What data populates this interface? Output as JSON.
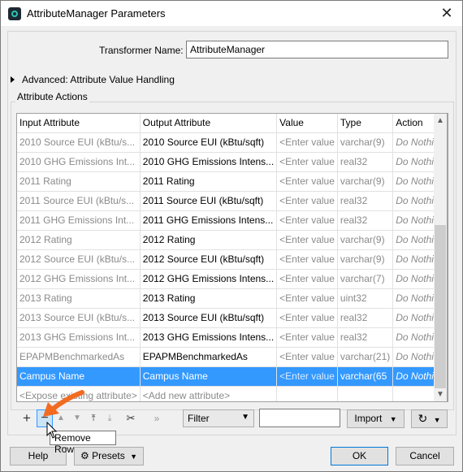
{
  "window": {
    "title": "AttributeManager Parameters"
  },
  "transformer": {
    "label": "Transformer Name:",
    "value": "AttributeManager"
  },
  "advanced": {
    "label": "Advanced: Attribute Value Handling"
  },
  "actions": {
    "label": "Attribute Actions",
    "columns": [
      "Input Attribute",
      "Output Attribute",
      "Value",
      "Type",
      "Action"
    ],
    "rows": [
      {
        "input": "2010 Source EUI (kBtu/s...",
        "output": "2010 Source EUI (kBtu/sqft)",
        "value": "<Enter value",
        "type": "varchar(9)",
        "action": "Do Nothing"
      },
      {
        "input": "2010 GHG Emissions Int...",
        "output": "2010 GHG Emissions Intens...",
        "value": "<Enter value",
        "type": "real32",
        "action": "Do Nothing"
      },
      {
        "input": "2011 Rating",
        "output": "2011 Rating",
        "value": "<Enter value",
        "type": "varchar(9)",
        "action": "Do Nothing"
      },
      {
        "input": "2011 Source EUI (kBtu/s...",
        "output": "2011 Source EUI (kBtu/sqft)",
        "value": "<Enter value",
        "type": "real32",
        "action": "Do Nothing"
      },
      {
        "input": "2011 GHG Emissions Int...",
        "output": "2011 GHG Emissions Intens...",
        "value": "<Enter value",
        "type": "real32",
        "action": "Do Nothing"
      },
      {
        "input": "2012 Rating",
        "output": "2012 Rating",
        "value": "<Enter value",
        "type": "varchar(9)",
        "action": "Do Nothing"
      },
      {
        "input": "2012 Source EUI (kBtu/s...",
        "output": "2012 Source EUI (kBtu/sqft)",
        "value": "<Enter value",
        "type": "varchar(9)",
        "action": "Do Nothing"
      },
      {
        "input": "2012 GHG Emissions Int...",
        "output": "2012 GHG Emissions Intens...",
        "value": "<Enter value",
        "type": "varchar(7)",
        "action": "Do Nothing"
      },
      {
        "input": "2013 Rating",
        "output": "2013 Rating",
        "value": "<Enter value",
        "type": "uint32",
        "action": "Do Nothing"
      },
      {
        "input": "2013 Source EUI (kBtu/s...",
        "output": "2013 Source EUI (kBtu/sqft)",
        "value": "<Enter value",
        "type": "real32",
        "action": "Do Nothing"
      },
      {
        "input": "2013 GHG Emissions Int...",
        "output": "2013 GHG Emissions Intens...",
        "value": "<Enter value",
        "type": "real32",
        "action": "Do Nothing"
      },
      {
        "input": "EPAPMBenchmarkedAs",
        "output": "EPAPMBenchmarkedAs",
        "value": "<Enter value",
        "type": "varchar(21)",
        "action": "Do Nothing"
      },
      {
        "input": "Campus Name",
        "output": "Campus Name",
        "value": "<Enter value",
        "type": "varchar(65",
        "action": "Do Nothing"
      }
    ],
    "new_row": {
      "input": "<Expose existing attribute>",
      "output": "<Add new attribute>"
    },
    "selected_index": 12
  },
  "toolbar": {
    "filter_select": "Filter",
    "import_label": "Import",
    "icons": [
      "plus-icon",
      "minus-icon",
      "move-up-icon",
      "move-down-icon",
      "move-top-icon",
      "move-bottom-icon",
      "cut-icon",
      "expand-icon"
    ]
  },
  "tooltip": "Remove Row",
  "footer": {
    "help": "Help",
    "presets": "Presets",
    "ok": "OK",
    "cancel": "Cancel"
  },
  "colors": {
    "selection": "#3399ff",
    "annotation_arrow": "#f26b21"
  }
}
